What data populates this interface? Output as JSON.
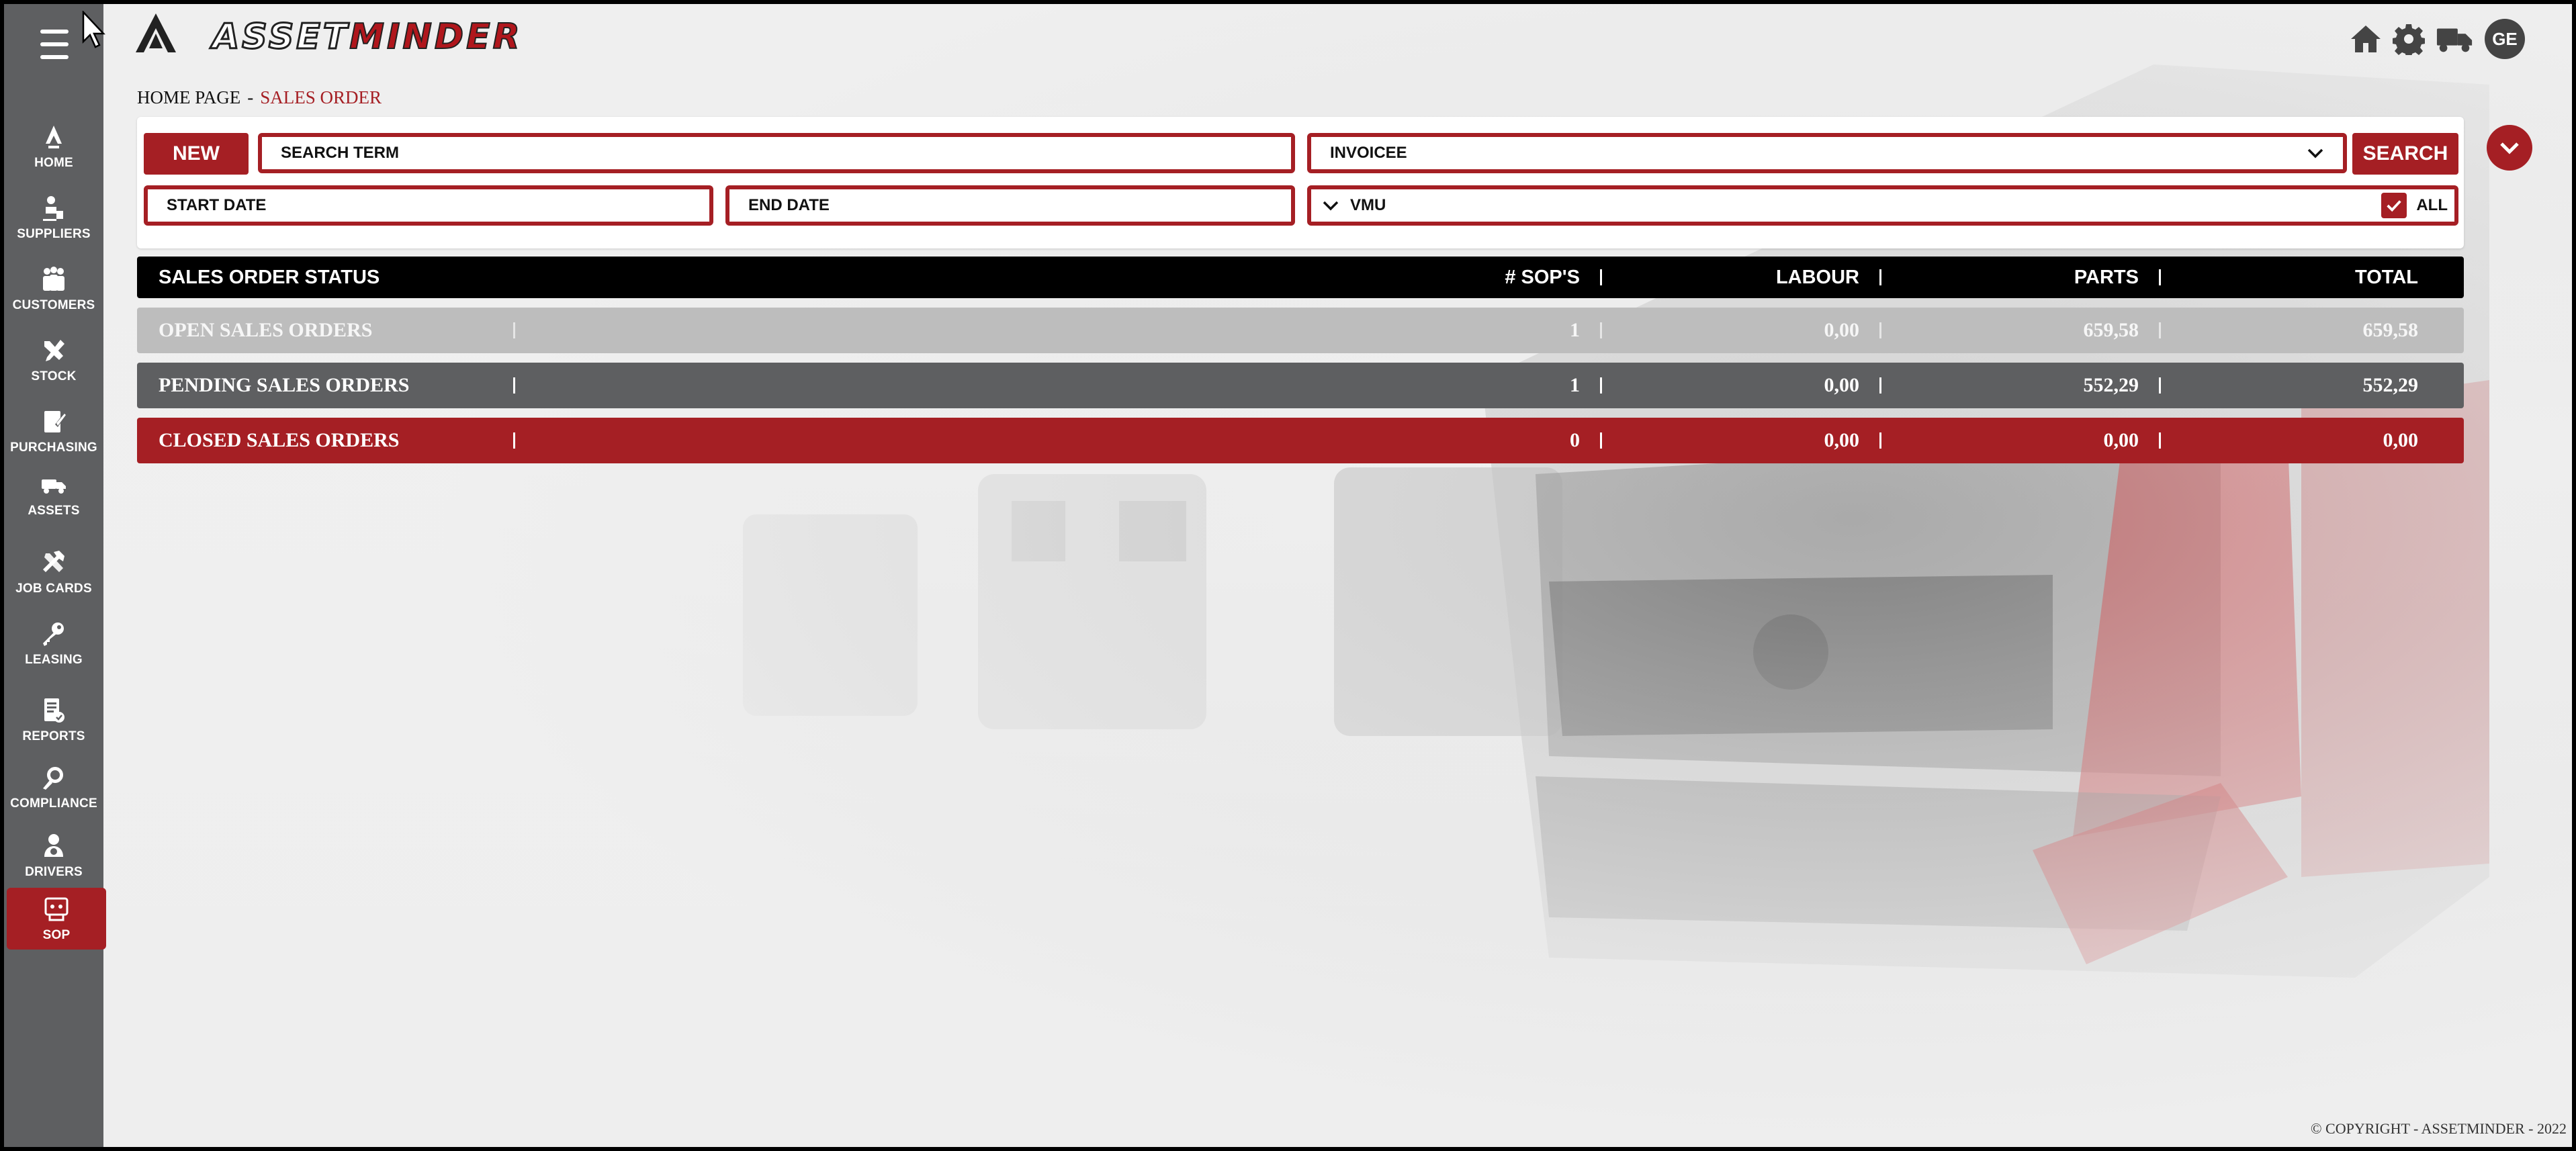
{
  "app": {
    "logo_part1": "ASSET",
    "logo_part2": "MINDER",
    "user_initials": "GE",
    "brand_color": "#a51f24"
  },
  "header_icons": [
    "home-icon",
    "gear-icon",
    "truck-icon"
  ],
  "sidebar": {
    "items": [
      {
        "label": "HOME",
        "icon": "home-icon"
      },
      {
        "label": "SUPPLIERS",
        "icon": "supplier-icon"
      },
      {
        "label": "CUSTOMERS",
        "icon": "customers-icon"
      },
      {
        "label": "STOCK",
        "icon": "tools-icon"
      },
      {
        "label": "PURCHASING",
        "icon": "purchasing-icon"
      },
      {
        "label": "ASSETS",
        "icon": "truck-icon"
      },
      {
        "label": "JOB CARDS",
        "icon": "wrench-icon"
      },
      {
        "label": "LEASING",
        "icon": "key-icon"
      },
      {
        "label": "REPORTS",
        "icon": "report-icon"
      },
      {
        "label": "COMPLIANCE",
        "icon": "compliance-icon"
      },
      {
        "label": "DRIVERS",
        "icon": "driver-icon"
      },
      {
        "label": "SOP",
        "icon": "sop-icon",
        "active": true
      }
    ]
  },
  "breadcrumb": {
    "home": "HOME PAGE",
    "separator": "-",
    "current": "SALES ORDER"
  },
  "search": {
    "new_label": "NEW",
    "search_term_placeholder": "SEARCH TERM",
    "invoicee_selected": "INVOICEE",
    "search_label": "SEARCH",
    "start_date_placeholder": "START DATE",
    "end_date_placeholder": "END DATE",
    "vmu_selected": "VMU",
    "all_label": "ALL",
    "all_checked": true
  },
  "table": {
    "headers": {
      "status": "SALES ORDER STATUS",
      "sops": "# SOP'S",
      "labour": "LABOUR",
      "parts": "PARTS",
      "total": "TOTAL"
    },
    "rows": [
      {
        "name": "OPEN SALES ORDERS",
        "sops": "1",
        "labour": "0,00",
        "parts": "659,58",
        "total": "659,58"
      },
      {
        "name": "PENDING SALES ORDERS",
        "sops": "1",
        "labour": "0,00",
        "parts": "552,29",
        "total": "552,29"
      },
      {
        "name": "CLOSED SALES ORDERS",
        "sops": "0",
        "labour": "0,00",
        "parts": "0,00",
        "total": "0,00"
      }
    ]
  },
  "footer": {
    "copyright": "© COPYRIGHT - ASSETMINDER - 2022"
  }
}
